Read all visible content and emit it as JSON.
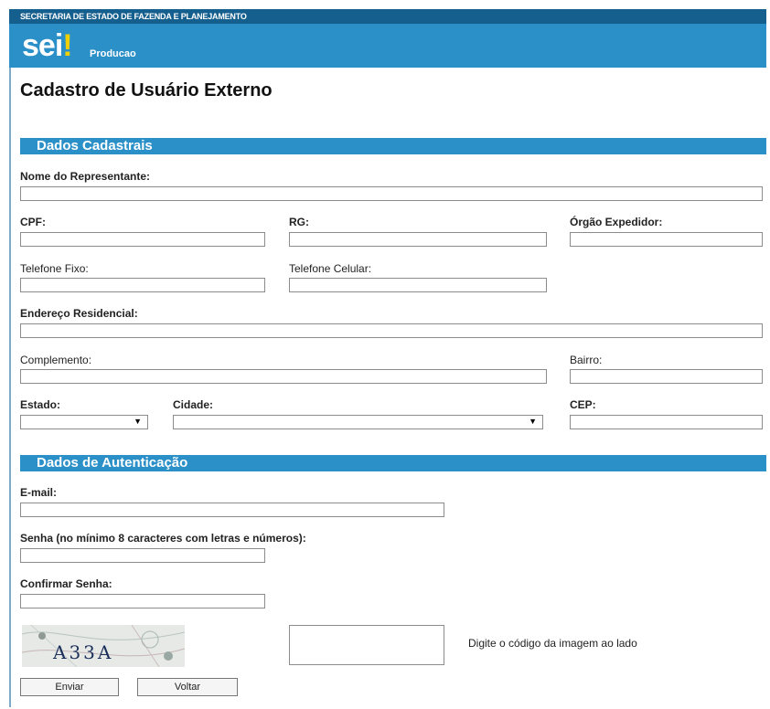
{
  "header": {
    "org": "SECRETARIA DE ESTADO DE FAZENDA E PLANEJAMENTO",
    "logo": "sei",
    "logo_dot": "!",
    "environment": "Producao"
  },
  "page_title": "Cadastro de Usuário Externo",
  "sections": {
    "cadastro": "Dados Cadastrais",
    "autenticacao": "Dados de Autenticação"
  },
  "labels": {
    "nome": "Nome do Representante:",
    "cpf": "CPF:",
    "rg": "RG:",
    "orgao": "Órgão Expedidor:",
    "tel_fixo": "Telefone Fixo:",
    "tel_cel": "Telefone Celular:",
    "endereco": "Endereço Residencial:",
    "complemento": "Complemento:",
    "bairro": "Bairro:",
    "estado": "Estado:",
    "cidade": "Cidade:",
    "cep": "CEP:",
    "email": "E-mail:",
    "senha": "Senha (no mínimo 8 caracteres com letras e números):",
    "confirmar": "Confirmar Senha:"
  },
  "captcha": {
    "text": "A33A",
    "hint": "Digite o código da imagem ao lado"
  },
  "buttons": {
    "enviar": "Enviar",
    "voltar": "Voltar"
  },
  "icons": {
    "dropdown": "chevron-down-icon"
  }
}
